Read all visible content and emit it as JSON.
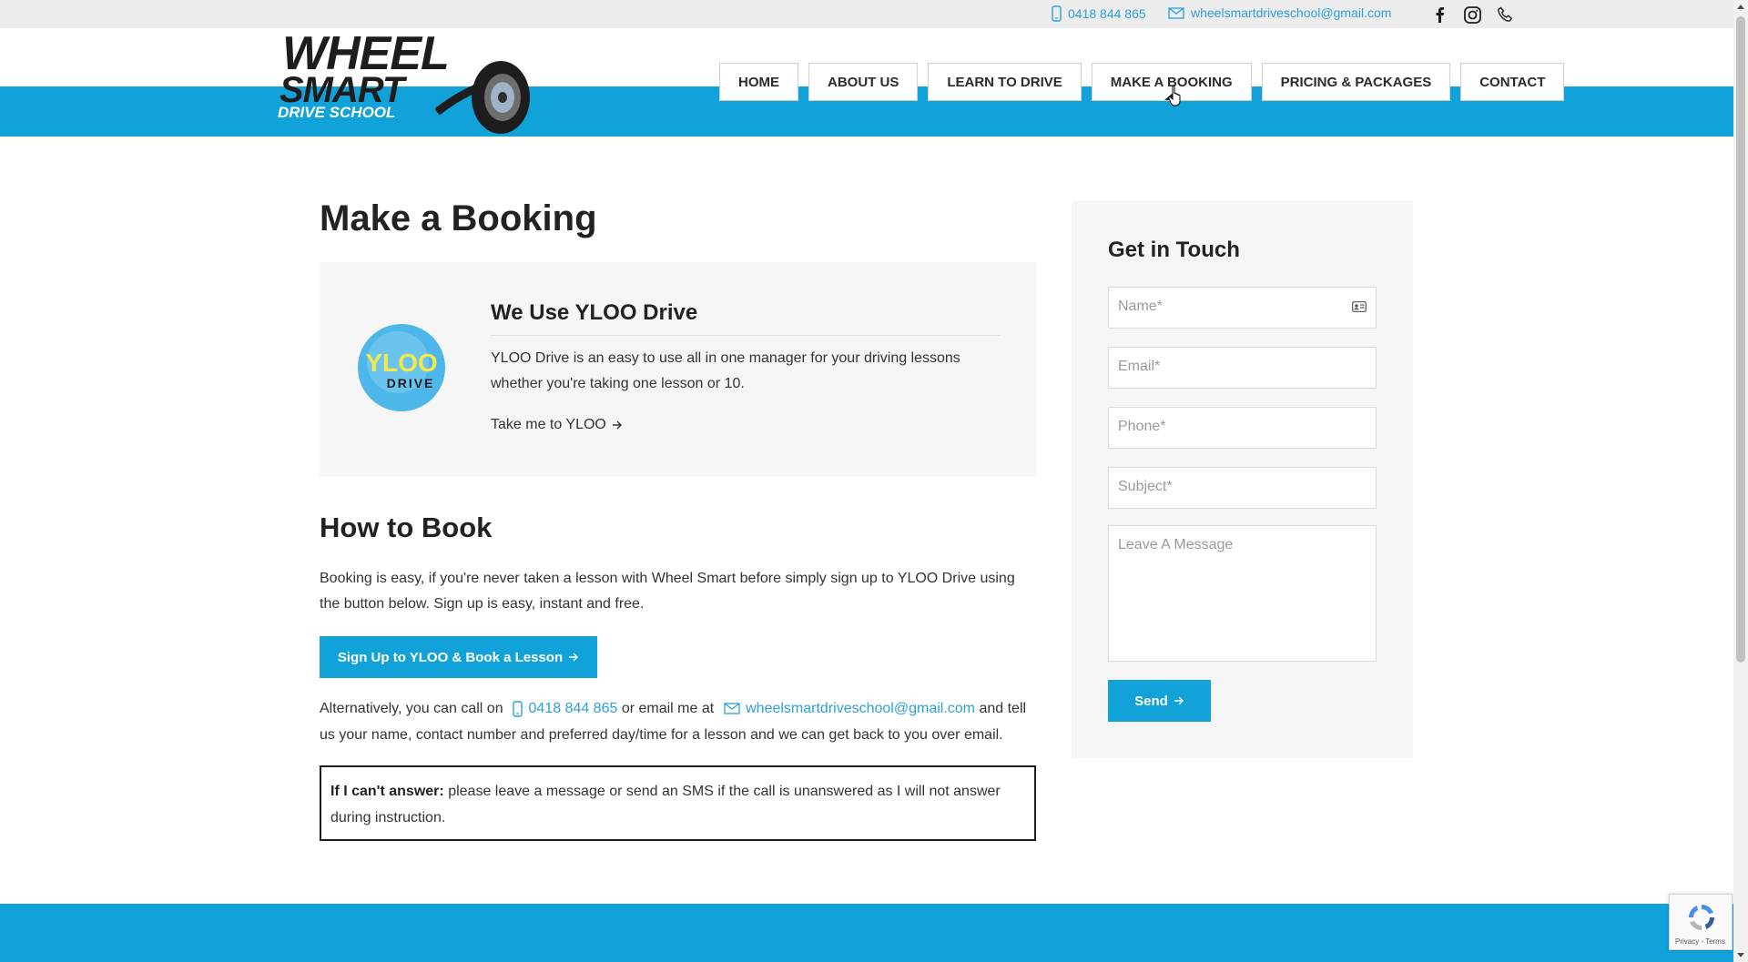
{
  "topbar": {
    "phone": "0418 844 865",
    "email": "wheelsmartdriveschool@gmail.com",
    "social_icons": [
      "facebook-icon",
      "instagram-icon",
      "phone-icon"
    ]
  },
  "logo": {
    "line1": "WHEEL",
    "line2": "SMART",
    "line3": "DRIVE SCHOOL"
  },
  "nav": {
    "items": [
      {
        "label": "HOME"
      },
      {
        "label": "ABOUT US"
      },
      {
        "label": "LEARN TO DRIVE"
      },
      {
        "label": "MAKE A BOOKING",
        "active": true
      },
      {
        "label": "PRICING & PACKAGES"
      },
      {
        "label": "CONTACT"
      }
    ]
  },
  "main": {
    "title": "Make a Booking",
    "ylo": {
      "logo_text1": "YLOO",
      "logo_text2": "DRIVE",
      "title": "We Use YLOO Drive",
      "description": "YLOO Drive is an easy to use all in one manager for your driving lessons whether you're taking one lesson or 10.",
      "link": "Take me to YLOO"
    },
    "how": {
      "title": "How to Book",
      "text": "Booking is easy, if you're never taken a lesson with Wheel Smart before simply sign up to YLOO Drive using the button below. Sign up is easy, instant and free.",
      "button": "Sign Up to YLOO & Book a Lesson"
    },
    "alternative": {
      "part1": "Alternatively, you can call on",
      "phone": "0418 844 865",
      "part2": "or email me at",
      "email": "wheelsmartdriveschool@gmail.com",
      "part3": "and tell us your name, contact number and preferred day/time for a lesson and we can get back to you over email."
    },
    "notice": {
      "bold": "If I can't answer:",
      "text": "please leave a message or send an SMS if the call is unanswered as I will not answer during instruction."
    }
  },
  "sidebar": {
    "title": "Get in Touch",
    "fields": {
      "name": "Name*",
      "email": "Email*",
      "phone": "Phone*",
      "subject": "Subject*",
      "message": "Leave A Message"
    },
    "send": "Send"
  },
  "recaptcha": {
    "text": "Privacy - Terms"
  },
  "colors": {
    "brand_blue": "#12a2da",
    "link_blue": "#2c9fd8"
  }
}
